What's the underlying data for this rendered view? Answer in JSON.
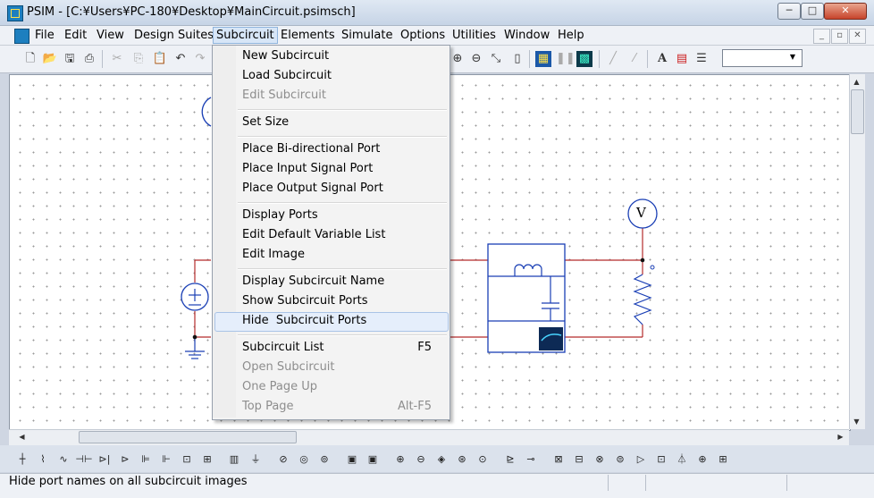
{
  "window": {
    "title": "PSIM - [C:¥Users¥PC-180¥Desktop¥MainCircuit.psimsch]",
    "minimize": "─",
    "maximize": "□",
    "close": "✕"
  },
  "menubar": {
    "items": [
      "File",
      "Edit",
      "View",
      "Design Suites",
      "Subcircuit",
      "Elements",
      "Simulate",
      "Options",
      "Utilities",
      "Window",
      "Help"
    ],
    "mdi_buttons": [
      "_",
      "▫",
      "✕"
    ]
  },
  "toolbar": {
    "icons": [
      "new-icon",
      "open-icon",
      "save-icon",
      "print-icon",
      "cut-icon",
      "copy-icon",
      "paste-icon",
      "undo-icon",
      "redo-icon",
      "zoom-in-icon",
      "zoom-out-icon",
      "zoom-fit-icon",
      "zoom-page-icon",
      "run-simulation-icon",
      "pause-icon",
      "simview-icon",
      "wire-icon",
      "label-icon",
      "text-icon",
      "image-icon",
      "element-list-icon"
    ],
    "zoom_value": ""
  },
  "subcircuit_menu": {
    "items": [
      {
        "label": "New Subcircuit",
        "enabled": true
      },
      {
        "label": "Load Subcircuit",
        "enabled": true
      },
      {
        "label": "Edit Subcircuit",
        "enabled": false
      },
      {
        "label": "Set Size",
        "enabled": true
      },
      {
        "label": "Place Bi-directional Port",
        "enabled": true
      },
      {
        "label": "Place Input Signal Port",
        "enabled": true
      },
      {
        "label": "Place Output Signal Port",
        "enabled": true
      },
      {
        "label": "Display Ports",
        "enabled": true
      },
      {
        "label": "Edit Default Variable List",
        "enabled": true
      },
      {
        "label": "Edit Image",
        "enabled": true
      },
      {
        "label": "Display Subcircuit Name",
        "enabled": true
      },
      {
        "label": "Show Subcircuit Ports",
        "enabled": true
      },
      {
        "label": "Hide  Subcircuit Ports",
        "enabled": true,
        "highlighted": true
      },
      {
        "label": "Subcircuit List",
        "enabled": true,
        "shortcut": "F5"
      },
      {
        "label": "Open Subcircuit",
        "enabled": false
      },
      {
        "label": "One Page Up",
        "enabled": false
      },
      {
        "label": "Top Page",
        "enabled": false,
        "shortcut": "Alt-F5"
      }
    ]
  },
  "circuit": {
    "voltmeter_label": "V",
    "source_label": "+"
  },
  "status": {
    "text": "Hide port names on all subcircuit images"
  },
  "colors": {
    "wire": "#b42b2b",
    "component": "#1a3fb5",
    "menu_highlight": "#e5eefb"
  }
}
